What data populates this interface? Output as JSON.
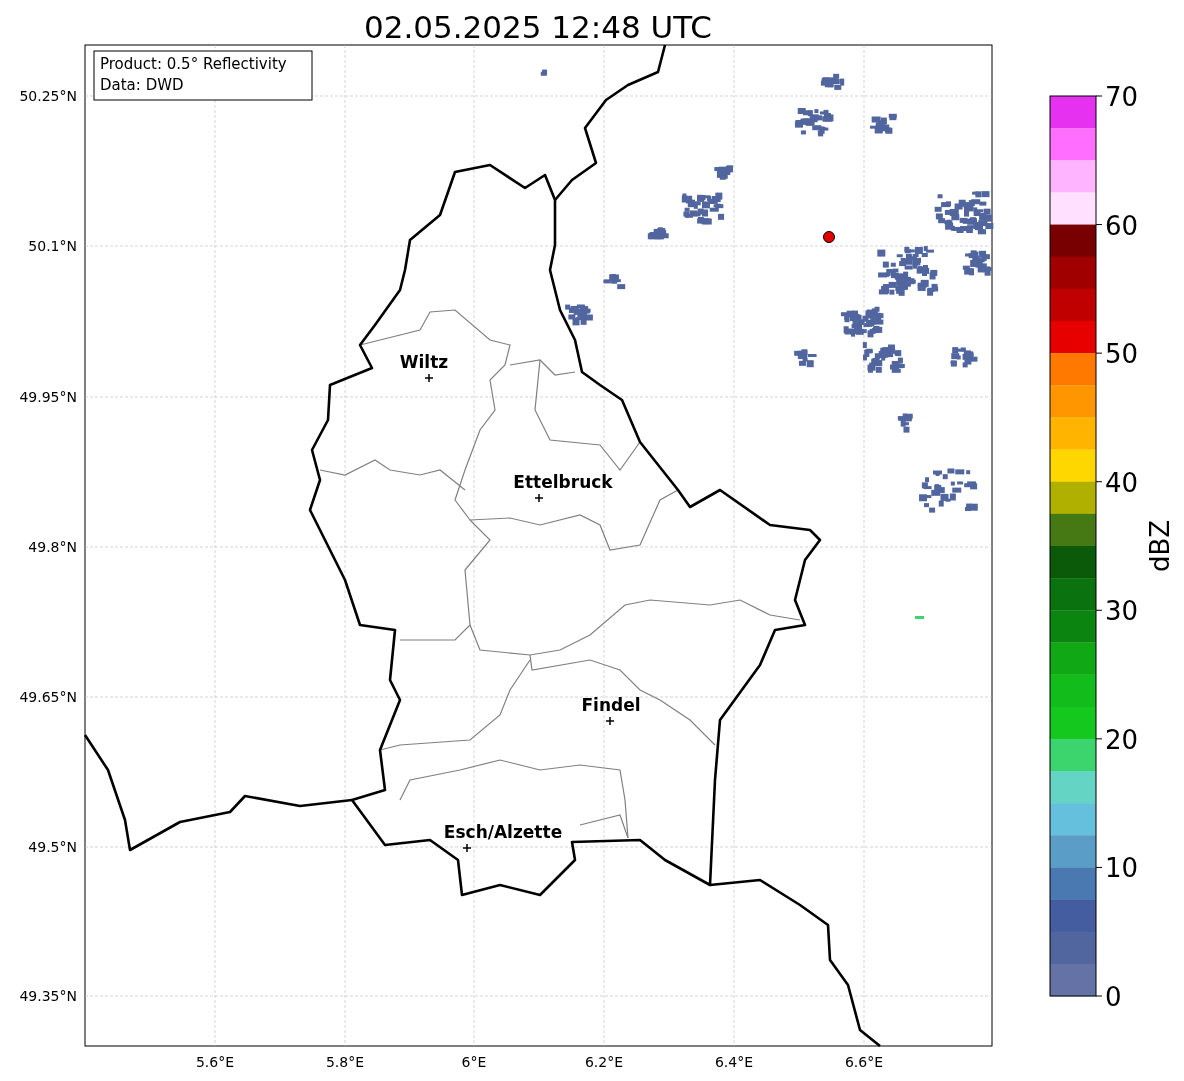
{
  "title": "02.05.2025 12:48 UTC",
  "info_box": [
    "Product: 0.5° Reflectivity",
    "Data: DWD"
  ],
  "lat_labels": [
    "50.25°N",
    "50.1°N",
    "49.95°N",
    "49.8°N",
    "49.65°N",
    "49.5°N",
    "49.35°N"
  ],
  "lon_labels": [
    "5.6°E",
    "5.8°E",
    "6°E",
    "6.2°E",
    "6.4°E",
    "6.6°E"
  ],
  "cities": [
    {
      "name": "Wiltz"
    },
    {
      "name": "Ettelbruck"
    },
    {
      "name": "Findel"
    },
    {
      "name": "Esch/Alzette"
    }
  ],
  "colorbar": {
    "label": "dBZ",
    "ticks": [
      "70",
      "60",
      "50",
      "40",
      "30",
      "20",
      "10",
      "0"
    ],
    "bands": [
      {
        "color": "#e632f0"
      },
      {
        "color": "#ff6eff"
      },
      {
        "color": "#ffb4ff"
      },
      {
        "color": "#ffe0ff"
      },
      {
        "color": "#780000"
      },
      {
        "color": "#a00000"
      },
      {
        "color": "#c00000"
      },
      {
        "color": "#e60000"
      },
      {
        "color": "#ff7800"
      },
      {
        "color": "#ff9600"
      },
      {
        "color": "#ffb400"
      },
      {
        "color": "#ffd700"
      },
      {
        "color": "#b0b000"
      },
      {
        "color": "#467814"
      },
      {
        "color": "#0a5a0a"
      },
      {
        "color": "#0a720e"
      },
      {
        "color": "#0c8410"
      },
      {
        "color": "#10a814"
      },
      {
        "color": "#12bc1a"
      },
      {
        "color": "#14c81e"
      },
      {
        "color": "#3cd46c"
      },
      {
        "color": "#64d4c4"
      },
      {
        "color": "#64c0dc"
      },
      {
        "color": "#5a9ec8"
      },
      {
        "color": "#4a78b0"
      },
      {
        "color": "#445da0"
      },
      {
        "color": "#51659e"
      },
      {
        "color": "#6472a6"
      }
    ]
  }
}
